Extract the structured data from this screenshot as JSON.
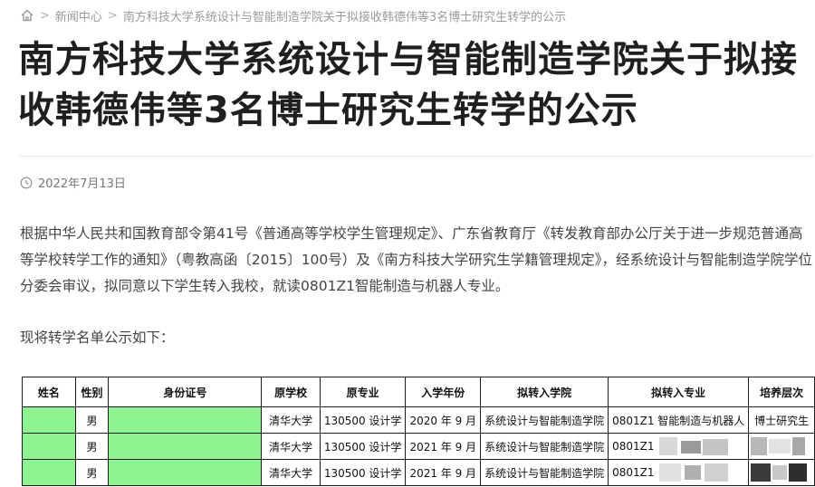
{
  "breadcrumb": {
    "items": [
      "新闻中心",
      "南方科技大学系统设计与智能制造学院关于拟接收韩德伟等3名博士研究生转学的公示"
    ]
  },
  "article": {
    "title": "南方科技大学系统设计与智能制造学院关于拟接收韩德伟等3名博士研究生转学的公示",
    "date": "2022年7月13日",
    "body": "根据中华人民共和国教育部令第41号《普通高等学校学生管理规定》、广东省教育厅《转发教育部办公厅关于进一步规范普通高等学校转学工作的通知》（粤教高函〔2015〕100号）及《南方科技大学研究生学籍管理规定》，经系统设计与智能制造学院学位分委会审议，拟同意以下学生转入我校，就读0801Z1智能制造与机器人专业。",
    "intro": "现将转学名单公示如下："
  },
  "table": {
    "headers": [
      "姓名",
      "性别",
      "身份证号",
      "原学校",
      "原专业",
      "入学年份",
      "拟转入学院",
      "拟转入专业",
      "培养层次"
    ],
    "rows": [
      [
        "",
        "男",
        "",
        "清华大学",
        "130500 设计学",
        "2020 年 9 月",
        "系统设计与智能制造学院",
        "0801Z1 智能制造与机器人",
        "博士研究生"
      ],
      [
        "",
        "男",
        "",
        "清华大学",
        "130500 设计学",
        "2021 年 9 月",
        "系统设计与智能制造学院",
        "0801Z1",
        ""
      ],
      [
        "",
        "男",
        "",
        "清华大学",
        "130500 设计学",
        "2021 年 9 月",
        "系统设计与智能制造学院",
        "0801Z1",
        ""
      ]
    ]
  },
  "colors": {
    "redaction_green": "#8ef28e",
    "title": "#1f1f1f",
    "muted": "#9a9a9a"
  },
  "icons": {
    "home": "home-icon",
    "clock": "clock-icon"
  }
}
